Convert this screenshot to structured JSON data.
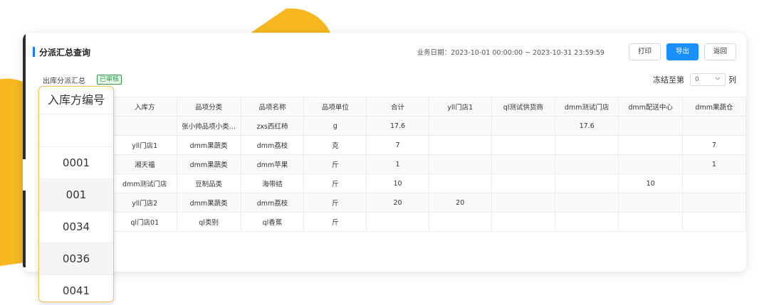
{
  "header": {
    "title": "分派汇总查询",
    "biz_date": "业务日期：2023-10-01 00:00:00 ~ 2023-10-31 23:59:59",
    "print_label": "打印",
    "export_label": "导出",
    "back_label": "返回"
  },
  "sub": {
    "label": "出库分派汇总",
    "status": "已审核",
    "freeze_label": "冻结至第",
    "freeze_value": "0",
    "freeze_unit": "列"
  },
  "table": {
    "columns": [
      "入库方",
      "品项分类",
      "品项名称",
      "品项单位",
      "合计",
      "yll门店1",
      "ql测试供货商",
      "dmm测试门店",
      "dmm配送中心",
      "dmm果蔬仓"
    ],
    "rows": [
      [
        "",
        "张小帅品项小类…",
        "zxs西红柿",
        "g",
        "17.6",
        "",
        "",
        "17.6",
        "",
        ""
      ],
      [
        "yll门店1",
        "dmm果蔬类",
        "dmm荔枝",
        "克",
        "7",
        "",
        "",
        "",
        "",
        "7"
      ],
      [
        "湘天福",
        "dmm果蔬类",
        "dmm苹果",
        "斤",
        "1",
        "",
        "",
        "",
        "",
        "1"
      ],
      [
        "dmm测试门店",
        "豆制品类",
        "海带结",
        "斤",
        "10",
        "",
        "",
        "",
        "10",
        ""
      ],
      [
        "yll门店2",
        "dmm果蔬类",
        "dmm荔枝",
        "斤",
        "20",
        "20",
        "",
        "",
        "",
        ""
      ],
      [
        "ql门店01",
        "ql类别",
        "ql香蕉",
        "斤",
        "",
        "",
        "",
        "",
        "",
        ""
      ]
    ]
  },
  "overlay": {
    "header": "入库方编号",
    "cells": [
      "",
      "0001",
      "001",
      "0034",
      "0036",
      "0041"
    ]
  },
  "colors": {
    "accent": "#1890ff",
    "highlight": "#f6b71f",
    "status_green": "#2e9e44"
  }
}
